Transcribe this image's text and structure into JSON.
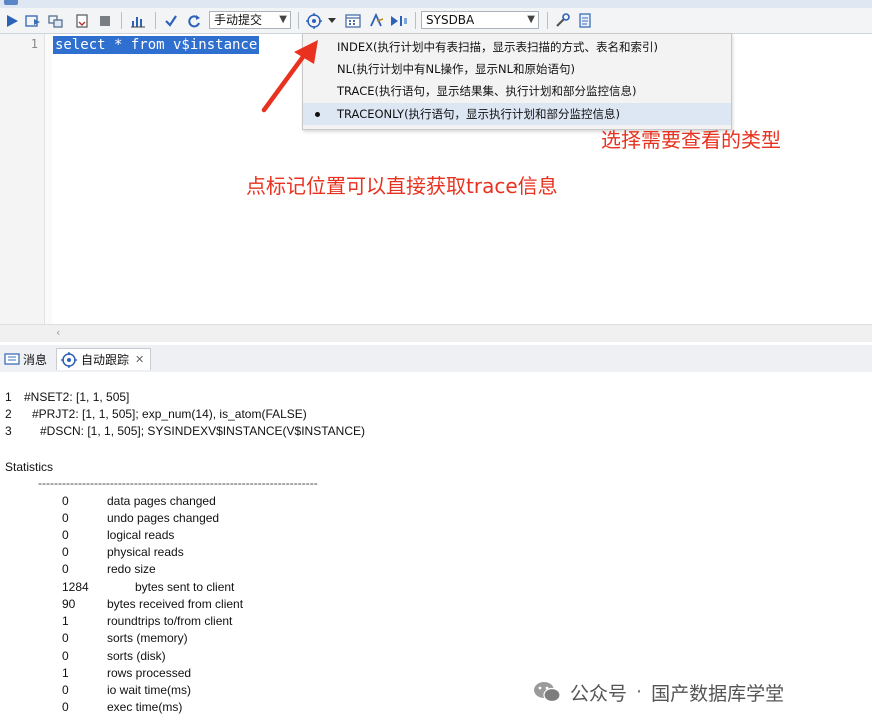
{
  "toolbar": {
    "commit_mode": "手动提交",
    "schema": "SYSDBA"
  },
  "editor": {
    "line_number": "1",
    "code": "select * from v$instance"
  },
  "trace_menu": {
    "items": [
      {
        "label": "INDEX(执行计划中有表扫描，显示表扫描的方式、表名和索引)"
      },
      {
        "label": "NL(执行计划中有NL操作，显示NL和原始语句)"
      },
      {
        "label": "TRACE(执行语句，显示结果集、执行计划和部分监控信息)"
      },
      {
        "label": "TRACEONLY(执行语句，显示执行计划和部分监控信息)"
      }
    ]
  },
  "annotations": {
    "select_type": "选择需要查看的类型",
    "click_marker": "点标记位置可以直接获取trace信息"
  },
  "bottom_tabs": {
    "messages": "消息",
    "autotrace": "自动跟踪"
  },
  "plan": [
    {
      "num": "1",
      "text": "#NSET2: [1, 1, 505]"
    },
    {
      "num": "2",
      "text": "#PRJT2: [1, 1, 505]; exp_num(14), is_atom(FALSE)"
    },
    {
      "num": "3",
      "text": "#DSCN: [1, 1, 505]; SYSINDEXV$INSTANCE(V$INSTANCE)"
    }
  ],
  "statistics": {
    "title": "Statistics",
    "divider": "----------------------------------------------------------------------",
    "rows": [
      {
        "value": "0",
        "name": "data pages changed"
      },
      {
        "value": "0",
        "name": "undo pages changed"
      },
      {
        "value": "0",
        "name": "logical reads"
      },
      {
        "value": "0",
        "name": "physical reads"
      },
      {
        "value": "0",
        "name": "redo size"
      },
      {
        "value": "1284",
        "name": "bytes sent to client"
      },
      {
        "value": "90",
        "name": "bytes received from client"
      },
      {
        "value": "1",
        "name": "roundtrips to/from client"
      },
      {
        "value": "0",
        "name": "sorts (memory)"
      },
      {
        "value": "0",
        "name": "sorts (disk)"
      },
      {
        "value": "1",
        "name": "rows processed"
      },
      {
        "value": "0",
        "name": "io wait time(ms)"
      },
      {
        "value": "0",
        "name": "exec time(ms)"
      }
    ]
  },
  "watermark": {
    "left": "公众号",
    "dot": "·",
    "right": "国产数据库学堂"
  },
  "colors": {
    "accent_red": "#e8321f",
    "selection_blue": "#2f6fd0"
  }
}
